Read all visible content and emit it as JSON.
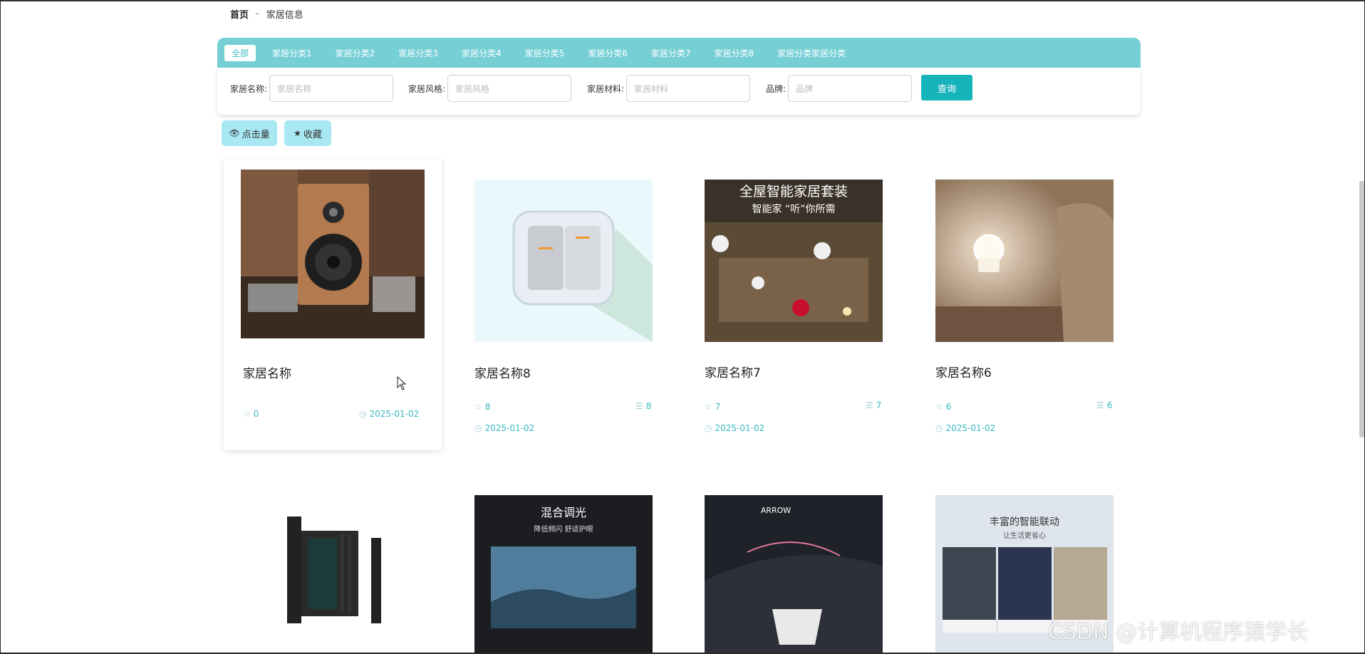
{
  "breadcrumb": {
    "home": "首页",
    "sep": "-",
    "current": "家居信息"
  },
  "categories": [
    "全部",
    "家居分类1",
    "家居分类2",
    "家居分类3",
    "家居分类4",
    "家居分类5",
    "家居分类6",
    "家居分类7",
    "家居分类8",
    "家居分类家居分类"
  ],
  "search": {
    "name_label": "家居名称:",
    "name_placeholder": "家居名称",
    "style_label": "家居风格:",
    "style_placeholder": "家居风格",
    "material_label": "家居材料:",
    "material_placeholder": "家居材料",
    "brand_label": "品牌:",
    "brand_placeholder": "品牌",
    "query_label": "查询"
  },
  "sort": {
    "clicks_label": "点击量",
    "fav_label": "收藏"
  },
  "cards": [
    {
      "name": "家居名称",
      "fav": "0",
      "date": "2025-01-02",
      "image": "speaker-photo"
    },
    {
      "name": "家居名称8",
      "fav": "8",
      "count": "8",
      "date": "2025-01-02",
      "image": "light-switch-photo"
    },
    {
      "name": "家居名称7",
      "fav": "7",
      "count": "7",
      "date": "2025-01-02",
      "image": "smart-home-set-photo",
      "img_title": "全屋智能家居套装",
      "img_sub": "智能家 “听”你所需"
    },
    {
      "name": "家居名称6",
      "fav": "6",
      "count": "6",
      "date": "2025-01-02",
      "image": "night-light-photo"
    }
  ],
  "row2": [
    {
      "image": "gate-photo"
    },
    {
      "image": "tv-photo",
      "img_title": "混合调光",
      "img_sub": "降低频闪 舒适护眼"
    },
    {
      "image": "toilet-photo",
      "img_title": "ARROW"
    },
    {
      "image": "linkage-photo",
      "img_title": "丰富的智能联动",
      "img_sub": "让生活更省心"
    }
  ],
  "watermark": "CSDN @计算机程序猿学长",
  "colors": {
    "accent": "#75cfd4",
    "button": "#17b3bb",
    "meta": "#39b9c2",
    "sort_bg": "#a8e8f2"
  }
}
